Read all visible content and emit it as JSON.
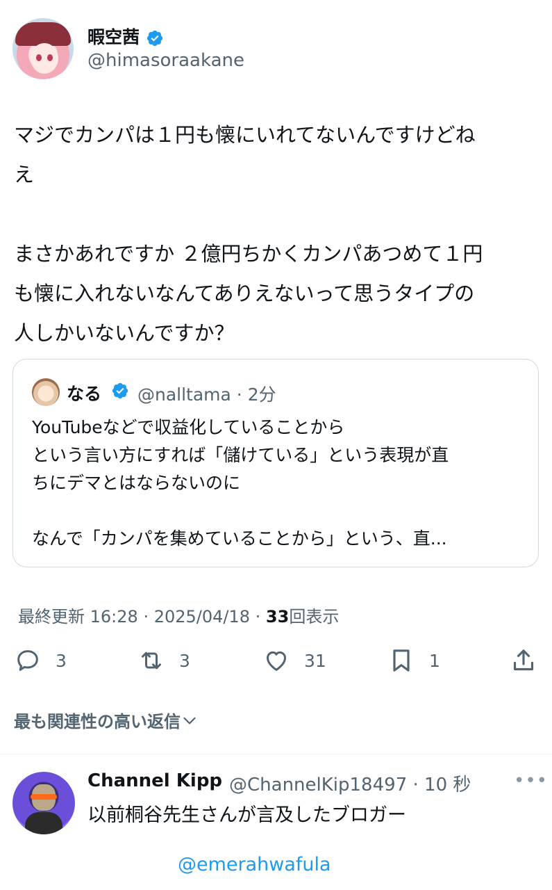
{
  "author": {
    "name": "暇空茜",
    "handle": "@himasoraakane",
    "verified_color": "#1d9bf0"
  },
  "tweet": {
    "text": "マジでカンパは１円も懐にいれてないんですけどね\nえ\n\nまさかあれですか ２億円ちかくカンパあつめて１円\nも懐に入れないなんてありえないって思うタイプの\n人しかいないんですか？"
  },
  "quote": {
    "name": "なる",
    "handle": "@nalltama",
    "time": "2分",
    "text": "YouTubeなどで収益化していることから\nという言い方にすれば「儲けている」という表現が直\nちにデマとはならないのに\n\nなんで「カンパを集めていることから」という、直..."
  },
  "meta": {
    "updated_label": "最終更新",
    "time": "16:28",
    "date": "2025/04/18",
    "views": "33",
    "views_label": "回表示"
  },
  "actions": {
    "replies": "3",
    "reposts": "3",
    "likes": "31",
    "bookmarks": "1"
  },
  "relevance_label": "最も関連性の高い返信",
  "reply": {
    "name": "Channel Kipp",
    "handle": "@ChannelKip18497",
    "time": "10 秒",
    "text": "以前桐谷先生さんが言及したブロガー",
    "mention": "@emerahwafula"
  }
}
